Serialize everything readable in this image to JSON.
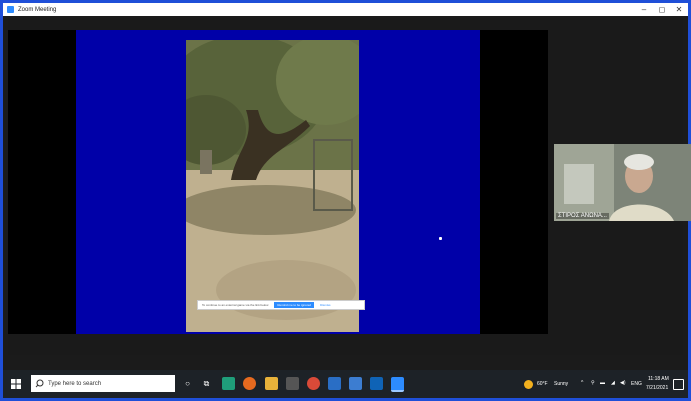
{
  "window": {
    "title": "Zoom Meeting",
    "minimize": "–",
    "maximize": "◻",
    "close": "✕"
  },
  "share": {
    "notice": {
      "text": "To continue to an external game via the link below",
      "primary": "Remind me to be ignored",
      "secondary": "Dismiss"
    }
  },
  "participant": {
    "name": "ΣΤΙΡΟΣ ΑΝΩΝΑ..."
  },
  "taskbar": {
    "search_placeholder": "Type here to search",
    "weather_temp": "60°F",
    "weather_text": "Sunny",
    "tray_lang": "ENG",
    "time": "11:18 AM",
    "date": "7/21/2021",
    "icons": [
      "cortana-icon",
      "task-view-icon",
      "edge-icon",
      "firefox-icon",
      "file-explorer-icon",
      "store-icon",
      "chrome-icon",
      "mail-icon",
      "office-icon",
      "outlook-icon",
      "zoom-icon"
    ]
  },
  "colors": {
    "share_bg": "#0000a8",
    "accent": "#2d8cff",
    "frame": "#1f4fd8"
  }
}
